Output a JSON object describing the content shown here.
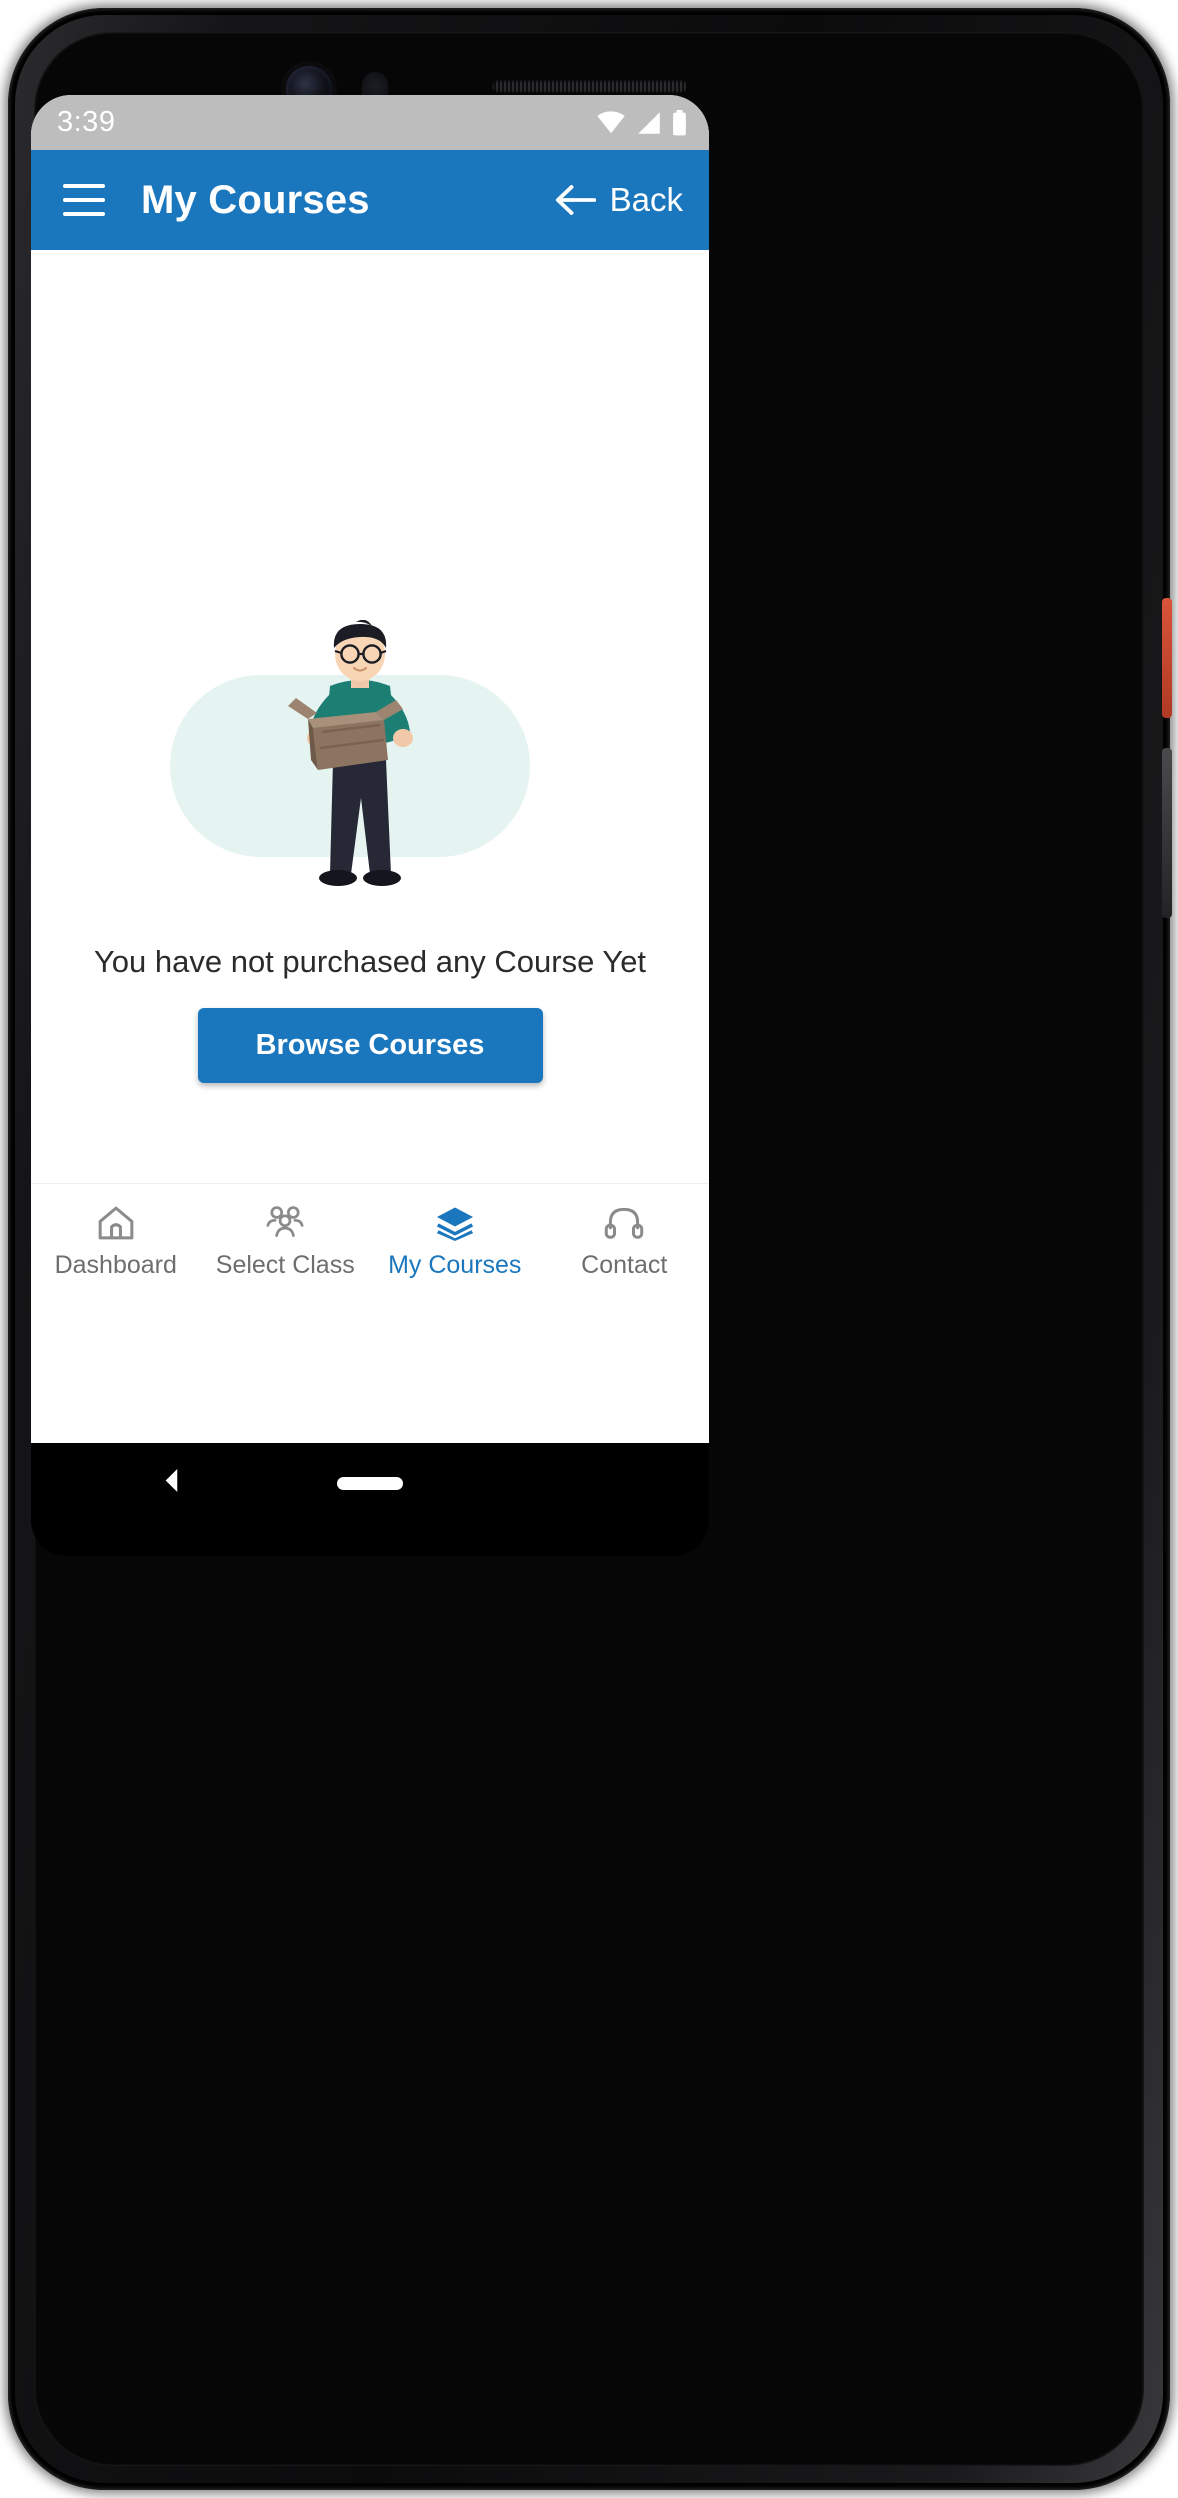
{
  "status_bar": {
    "time": "3:39",
    "icons": [
      "wifi-icon",
      "cellular-signal-icon",
      "battery-icon"
    ]
  },
  "app_bar": {
    "menu_icon": "hamburger-menu-icon",
    "title": "My Courses",
    "back_icon": "arrow-left-icon",
    "back_label": "Back",
    "background_color": "#1b77bd"
  },
  "content": {
    "illustration": "empty-box-person-illustration",
    "empty_message": "You have not purchased any Course Yet",
    "primary_button_label": "Browse Courses",
    "primary_button_color": "#1b77bd"
  },
  "bottom_nav": {
    "active_color": "#1b77bd",
    "inactive_color": "#6e6e6e",
    "items": [
      {
        "label": "Dashboard",
        "icon": "home-icon",
        "active": false
      },
      {
        "label": "Select Class",
        "icon": "people-group-icon",
        "active": false
      },
      {
        "label": "My Courses",
        "icon": "layers-icon",
        "active": true
      },
      {
        "label": "Contact",
        "icon": "headset-icon",
        "active": false
      }
    ]
  },
  "system_nav": {
    "back_icon": "android-back-icon",
    "home_indicator": "home-pill-indicator"
  }
}
